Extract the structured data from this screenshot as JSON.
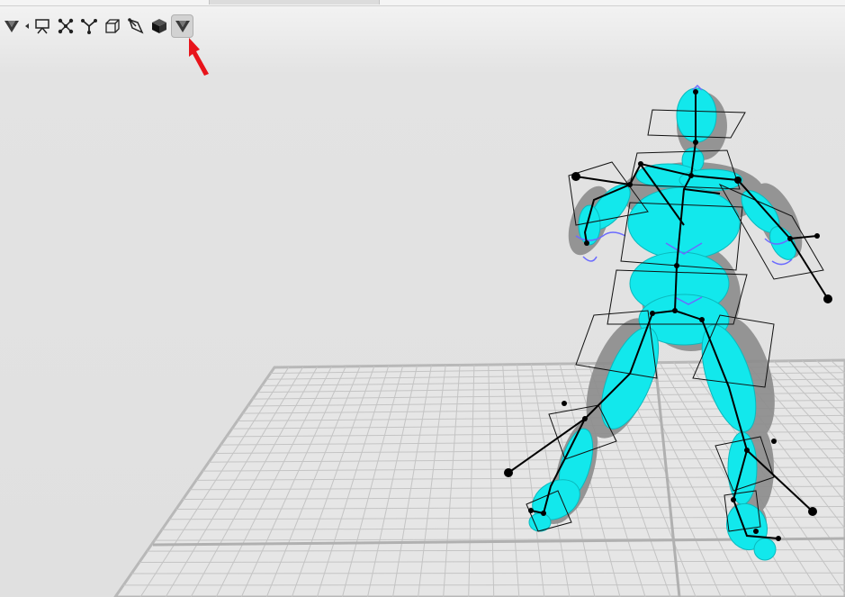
{
  "window": {
    "title": ""
  },
  "toolbar": {
    "tools": [
      {
        "name": "logo-tool",
        "icon": "v-logo-icon"
      },
      {
        "name": "display-toggle",
        "icon": "presentation-board-icon"
      },
      {
        "name": "joint-tool",
        "icon": "scatter-nodes-icon"
      },
      {
        "name": "skeleton-tool",
        "icon": "y-branch-icon"
      },
      {
        "name": "box-tool",
        "icon": "wire-box-icon"
      },
      {
        "name": "pen-tool",
        "icon": "pen-nib-icon"
      },
      {
        "name": "solid-cube-tool",
        "icon": "solid-cube-icon"
      },
      {
        "name": "v-tool-active",
        "icon": "v-logo-icon"
      }
    ],
    "active_index": 7
  },
  "annotation": {
    "arrow_color": "#e8141b",
    "target": "v-tool-active"
  },
  "colors": {
    "background": "#e3e3e3",
    "grid": "#bdbdbd",
    "body_cyan": "#10e6ea",
    "mesh_gray": "#8a8a8a",
    "bone": "#000000",
    "wire": "#6b6bff"
  }
}
